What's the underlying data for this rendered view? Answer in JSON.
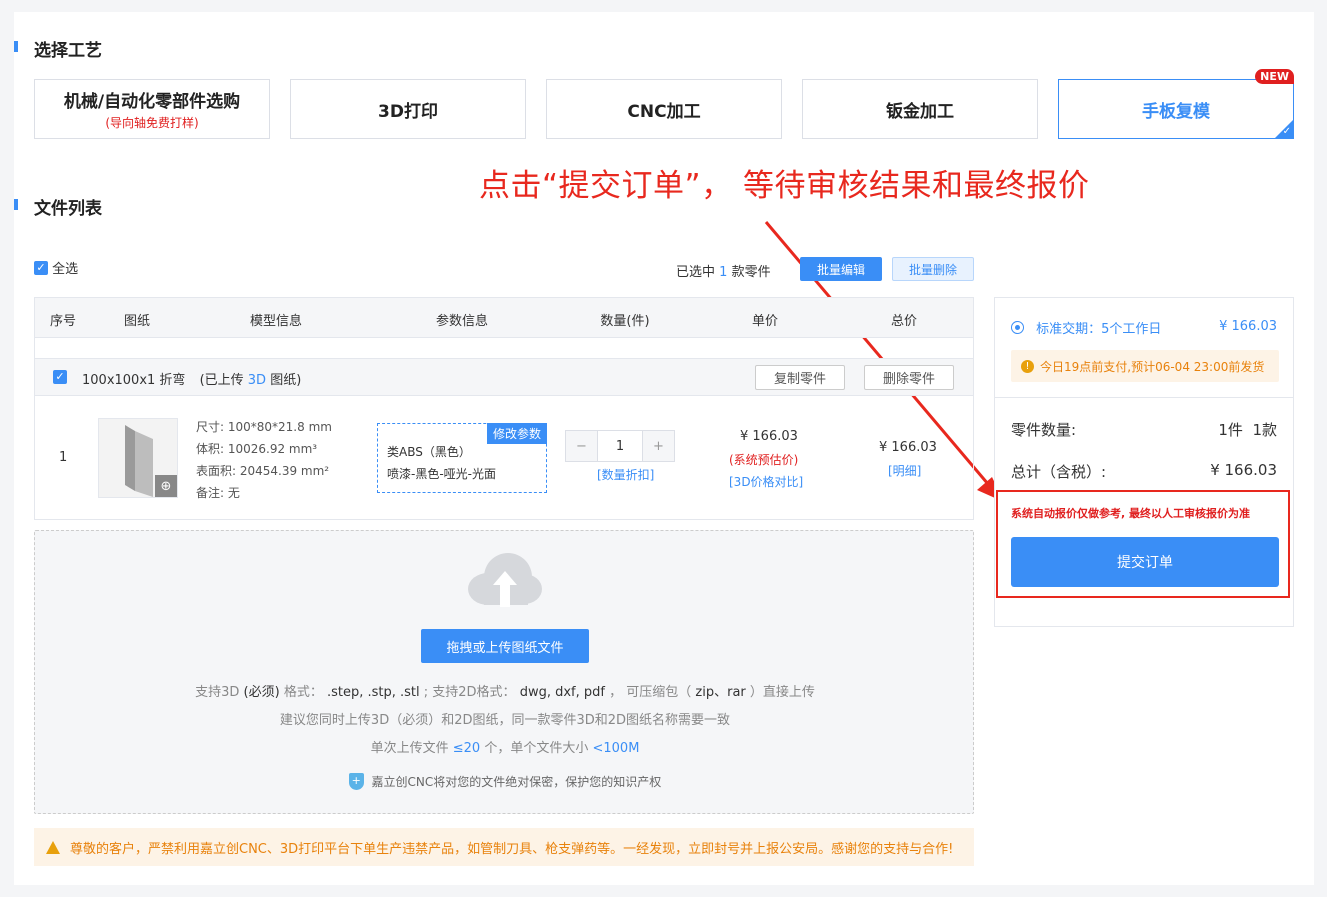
{
  "sections": {
    "craft_title": "选择工艺",
    "files_title": "文件列表"
  },
  "crafts": [
    {
      "title": "机械/自动化零部件选购",
      "subtitle": "(导向轴免费打样)"
    },
    {
      "title": "3D打印"
    },
    {
      "title": "CNC加工"
    },
    {
      "title": "钣金加工"
    },
    {
      "title": "手板复模",
      "badge": "NEW",
      "active": true
    }
  ],
  "annotation": "点击“提交订单”， 等待审核结果和最终报价",
  "toolbar": {
    "select_all": "全选",
    "selected_prefix": "已选中",
    "selected_count": "1",
    "selected_suffix": "款零件",
    "batch_edit": "批量编辑",
    "batch_delete": "批量删除"
  },
  "table": {
    "headers": [
      "序号",
      "图纸",
      "模型信息",
      "参数信息",
      "数量(件)",
      "单价",
      "总价"
    ],
    "group": {
      "name": "100x100x1 折弯",
      "upload_prefix": "(已上传",
      "upload_type": "3D",
      "upload_suffix": "图纸)",
      "copy_btn": "复制零件",
      "delete_btn": "删除零件"
    },
    "row": {
      "index": "1",
      "size": "尺寸: 100*80*21.8 mm",
      "volume": "体积: 10026.92 mm³",
      "area": "表面积: 20454.39 mm²",
      "note": "备注: 无",
      "edit_tag": "修改参数",
      "material": "类ABS（黑色）",
      "finish": "喷漆-黑色-哑光-光面",
      "qty": "1",
      "qty_link": "[数量折扣]",
      "unit_price": "¥ 166.03",
      "unit_note": "(系统预估价)",
      "unit_link": "[3D价格对比]",
      "total_price": "¥ 166.03",
      "total_link": "[明细]"
    }
  },
  "upload": {
    "button": "拖拽或上传图纸文件",
    "line1_a": "支持3D",
    "line1_b": "(必须)",
    "line1_c": "格式：",
    "line1_d": ".step, .stp, .stl",
    "line1_e": "; 支持2D格式：",
    "line1_f": "dwg, dxf, pdf",
    "line1_g": "， 可压缩包（",
    "line1_h": "zip、rar",
    "line1_i": "）直接上传",
    "line2": "建议您同时上传3D（必须）和2D图纸，同一款零件3D和2D图纸名称需要一致",
    "line3_a": "单次上传文件",
    "line3_b": "≤20",
    "line3_c": "个，单个文件大小",
    "line3_d": "<100M",
    "secure": "嘉立创CNC将对您的文件绝对保密，保护您的知识产权"
  },
  "warning": "尊敬的客户，严禁利用嘉立创CNC、3D打印平台下单生产违禁产品，如管制刀具、枪支弹药等。一经发现，立即封号并上报公安局。感谢您的支持与合作!",
  "side": {
    "delivery_label": "标准交期：",
    "delivery_value": "5个工作日",
    "delivery_price": "¥ 166.03",
    "notice": "今日19点前支付,预计06-04 23:00前发货",
    "count_label": "零件数量:",
    "count_value": "1件  1款",
    "total_label": "总计（含税）:",
    "total_value": "¥ 166.03",
    "disclaimer": "系统自动报价仅做参考, 最终以人工审核报价为准",
    "submit": "提交订单"
  },
  "colors": {
    "primary": "#3a8ef6",
    "alert": "#e8281e",
    "warn": "#e8820c"
  }
}
